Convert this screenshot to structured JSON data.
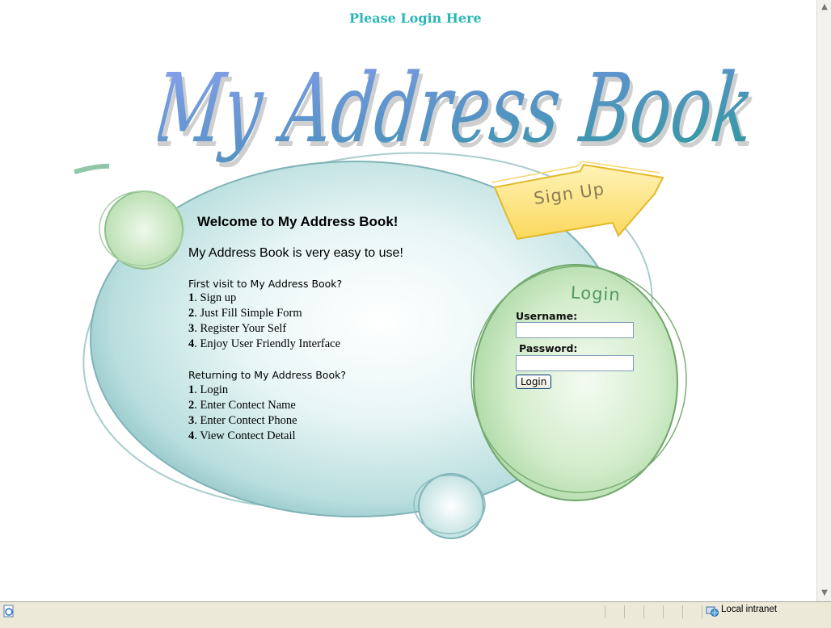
{
  "header": {
    "prompt": "Please Login Here"
  },
  "logo": {
    "text": "My Address Book"
  },
  "signup": {
    "label": "Sign Up"
  },
  "intro": {
    "welcome": "Welcome to My Address Book!",
    "tagline": "My Address Book is very easy to use!",
    "first_visit": {
      "heading": "First visit to My Address Book?",
      "steps": [
        {
          "num": "1",
          "text": ". Sign up"
        },
        {
          "num": "2",
          "text": ". Just Fill Simple Form"
        },
        {
          "num": "3",
          "text": ". Register Your Self"
        },
        {
          "num": "4",
          "text": ". Enjoy User Friendly Interface"
        }
      ]
    },
    "returning": {
      "heading": "Returning to My Address Book?",
      "steps": [
        {
          "num": "1",
          "text": ". Login"
        },
        {
          "num": "2",
          "text": ". Enter Contect Name"
        },
        {
          "num": "3",
          "text": ". Enter Contect Phone"
        },
        {
          "num": "4",
          "text": ". View Contect Detail"
        }
      ]
    }
  },
  "login": {
    "title": "Login",
    "username_label": "Username:",
    "username_value": "",
    "password_label": "Password:",
    "password_value": "",
    "button_label": "Login"
  },
  "statusbar": {
    "zone": "Local intranet"
  },
  "icons": {
    "page_icon": "ie-page-icon",
    "zone_icon": "intranet-globe-icon"
  },
  "colors": {
    "heading_teal": "#2ab7b4",
    "sign_up_yellow": "#fde37a",
    "bubble_green": "#c8e8c0"
  }
}
